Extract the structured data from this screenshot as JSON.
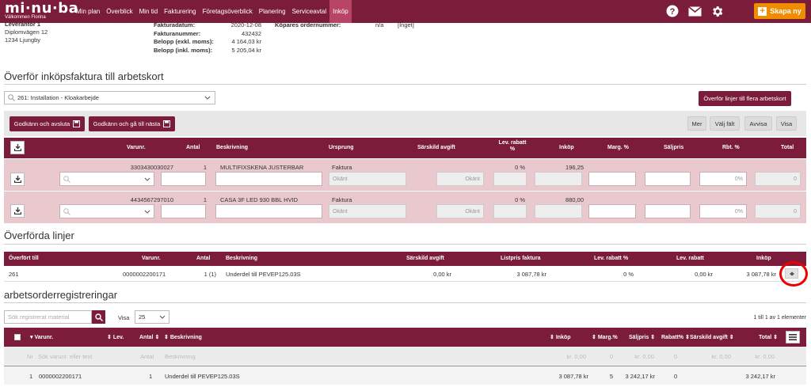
{
  "nav": {
    "logo": "mi·nu·ba",
    "subtitle": "Välkommen Florina",
    "items": [
      "Min plan",
      "Överblick",
      "Min tid",
      "Fakturering",
      "Företagsöverblick",
      "Planering",
      "Serviceavtal",
      "Inköp"
    ],
    "skapa_label": "Skapa ny",
    "icons": [
      "help-icon",
      "mail-icon",
      "gear-icon"
    ]
  },
  "supplier": {
    "label": "Leverantör 1",
    "street": "Diplomvägen 12",
    "city": "1234 Ljungby"
  },
  "invoice": {
    "date_label": "Fakturadatum:",
    "date": "2020-12-08",
    "number_label": "Fakturanummer:",
    "number": "432432",
    "excl_label": "Belopp (exkl. moms):",
    "excl": "4 164,03 kr",
    "incl_label": "Belopp (inkl. moms):",
    "incl": "5 205,04 kr",
    "buyer_label": "Köpares ordernummer:",
    "buyer_value": "n/a",
    "buyer_extra": "[Inget]"
  },
  "transfer": {
    "title": "Överför inköpsfaktura till arbetskort",
    "work_order": "261: Installation - Kloakarbejde",
    "multi_btn": "Överför linjer till flera arbetskort",
    "approve_close": "Godkänn och avsluta",
    "approve_next": "Godkänn och gå till nästa",
    "btn_more": "Mer",
    "btn_choose": "Välj fält",
    "btn_reject": "Avvisa",
    "btn_show": "Visa",
    "headers": [
      "Varunr.",
      "Antal",
      "Beskrivning",
      "Ursprung",
      "Särskild avgift",
      "Lev. rabatt %",
      "Inköp",
      "Marg. %",
      "Säljpris",
      "Rbt. %",
      "Total"
    ],
    "rows": [
      {
        "varunr": "3303430030027",
        "antal": "1",
        "beskrivning": "MULTIFIXSKENA JUSTERBAR",
        "ursprung": "Faktura",
        "avgift": "Okänt",
        "rabatt": "0 %",
        "inkop": "196,25",
        "rbt": "0%",
        "total": "0"
      },
      {
        "varunr": "4434567297010",
        "antal": "1",
        "beskrivning": "CASA 3F LED 930 BBL HVID",
        "ursprung": "Faktura",
        "avgift": "Okänt",
        "rabatt": "0 %",
        "inkop": "880,00",
        "rbt": "0%",
        "total": "0"
      }
    ]
  },
  "transferred": {
    "title": "Överförda linjer",
    "headers": [
      "Överfört till",
      "Varunr.",
      "Antal",
      "Beskrivning",
      "Särskild avgift",
      "Listpris faktura",
      "Lev. rabatt %",
      "Lev. rabatt",
      "Inköp"
    ],
    "row": {
      "till": "261",
      "varunr": "0000002200171",
      "antal": "1 (1)",
      "beskrivning": "Underdel till PEVEP125.03S",
      "avgift": "0,00 kr",
      "listpris": "3 087,78 kr",
      "levrab_pct": "0 %",
      "levrab": "0,00 kr",
      "inkop": "3 087,78 kr"
    }
  },
  "registrations": {
    "title": "arbetsorderregistreringar",
    "search_placeholder": "Sök registrerat material",
    "visa_label": "Visa",
    "visa_value": "25",
    "count": "1 till 1 av 1 elementer",
    "headers": [
      "Varunr.",
      "Lev.",
      "Antal",
      "Beskrivning",
      "Inköp",
      "Marg.%",
      "Säljpris",
      "Rabatt%",
      "Särskild avgift",
      "Total"
    ],
    "filter": {
      "nr": "Nr",
      "varunr": "Sök varunr. eller text",
      "antal": "Antal",
      "beskrivning": "Beskrivning",
      "inkop": "kr. 0,00",
      "marg": "0",
      "saljpris": "kr. 0,00",
      "rabatt": "0",
      "avgift": "kr. 0,00",
      "total": "kr. 0,00"
    },
    "row": {
      "nr": "1",
      "varunr": "0000002200171",
      "antal": "1",
      "beskrivning": "Underdel till PEVEP125.03S",
      "inkop": "3 087,78 kr",
      "marg": "5",
      "saljpris": "3 242,17 kr",
      "rabatt": "0",
      "total": "3 242,17 kr"
    }
  },
  "colors": {
    "brand": "#7b1c3a",
    "accent": "#f08c00",
    "pink": "#e9c9cd"
  }
}
